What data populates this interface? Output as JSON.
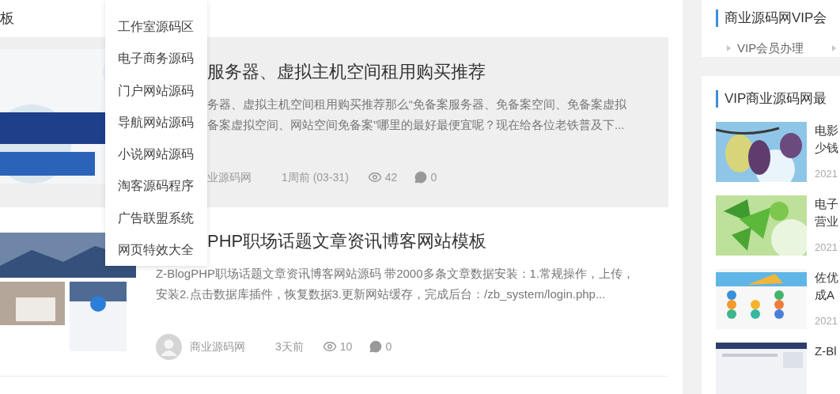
{
  "header": {
    "title": "板"
  },
  "menu": {
    "items": [
      {
        "label": "工作室源码区"
      },
      {
        "label": "电子商务源码"
      },
      {
        "label": "门户网站源码"
      },
      {
        "label": "导航网站源码"
      },
      {
        "label": "小说网站源码"
      },
      {
        "label": "淘客源码程序"
      },
      {
        "label": "广告联盟系统"
      },
      {
        "label": "网页特效大全"
      }
    ]
  },
  "articles": [
    {
      "title": "服务器、虚拟主机空间租用购买推荐",
      "excerpt_lines": [
        "务器、虚拟主机空间租用购买推荐那么“免备案服务器、免备案空间、免备案虚拟",
        "备案虚拟空间、网站空间免备案”哪里的最好最便宜呢？现在给各位老铁普及下..."
      ],
      "covered": true,
      "highlighted": true,
      "avatar": false,
      "author": "业源码网",
      "time": "1周前 (03-31)",
      "views": "42",
      "comments": "0"
    },
    {
      "title": "PHP职场话题文章资讯博客网站模板",
      "excerpt_lines": [
        "Z-BlogPHP职场话题文章资讯博客网站源码 带2000多条文章数据安装：1.常规操作，上传，",
        "安装2.点击数据库插件，恢复数据3.更新网站缓存，完成后台：/zb_system/login.php..."
      ],
      "covered": false,
      "highlighted": false,
      "avatar": true,
      "author": "商业源码网",
      "time": "3天前",
      "views": "10",
      "comments": "0"
    }
  ],
  "sidebar": {
    "vip_card": {
      "title": "商业源码网VIP会",
      "links": [
        {
          "label": "VIP会员办理"
        }
      ]
    },
    "latest_card": {
      "title": "VIP商业源码网最",
      "items": [
        {
          "kind": "leaves",
          "title_lines": [
            "电影",
            "少钱"
          ],
          "date": "2021"
        },
        {
          "kind": "ginkgo",
          "title_lines": [
            "电子",
            "营业"
          ],
          "date": "2021"
        },
        {
          "kind": "app",
          "title_lines": [
            "佐优",
            "成A"
          ],
          "date": "2021"
        },
        {
          "kind": "site",
          "title_lines": [
            "Z-Bl"
          ]
        }
      ]
    }
  }
}
